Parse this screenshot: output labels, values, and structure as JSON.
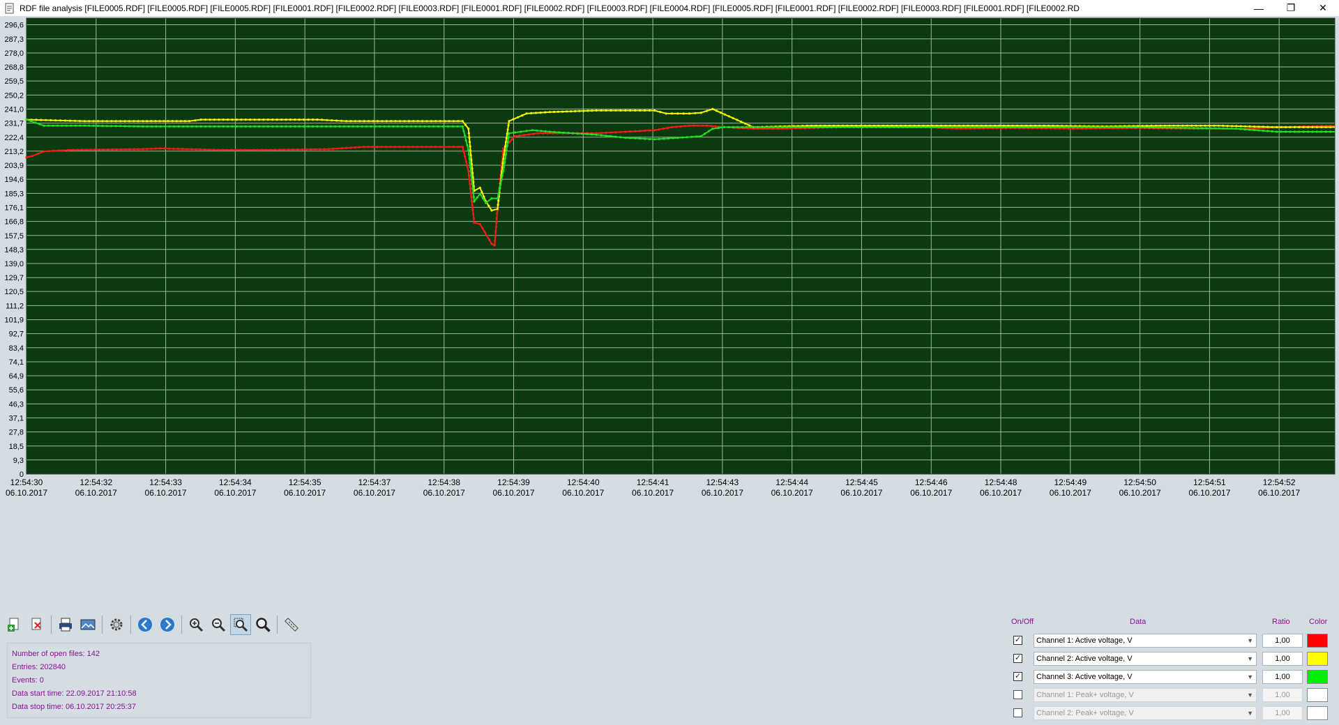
{
  "window": {
    "title": "RDF file analysis [FILE0005.RDF] [FILE0005.RDF] [FILE0005.RDF] [FILE0001.RDF] [FILE0002.RDF] [FILE0003.RDF] [FILE0001.RDF] [FILE0002.RDF] [FILE0003.RDF] [FILE0004.RDF] [FILE0005.RDF] [FILE0001.RDF] [FILE0002.RDF] [FILE0003.RDF] [FILE0001.RDF] [FILE0002.RD",
    "minimize": "—",
    "restore": "❐",
    "close": "✕"
  },
  "chart_data": {
    "type": "line",
    "title": "",
    "xlabel": "",
    "ylabel": "",
    "ylim": [
      0,
      301
    ],
    "grid": true,
    "legend": "none",
    "background_color": "#0c3a10",
    "grid_color": "#9fb79c",
    "y_ticks": [
      "0",
      "9,3",
      "18,5",
      "27,8",
      "37,1",
      "46,3",
      "55,6",
      "64,9",
      "74,1",
      "83,4",
      "92,7",
      "101,9",
      "111,2",
      "120,5",
      "129,7",
      "139,0",
      "148,3",
      "157,5",
      "166,8",
      "176,1",
      "185,3",
      "194,6",
      "203,9",
      "213,2",
      "222,4",
      "231,7",
      "241,0",
      "250,2",
      "259,5",
      "268,8",
      "278,0",
      "287,3",
      "296,6"
    ],
    "x_ticks": [
      {
        "time": "12:54:30",
        "date": "06.10.2017"
      },
      {
        "time": "12:54:32",
        "date": "06.10.2017"
      },
      {
        "time": "12:54:33",
        "date": "06.10.2017"
      },
      {
        "time": "12:54:34",
        "date": "06.10.2017"
      },
      {
        "time": "12:54:35",
        "date": "06.10.2017"
      },
      {
        "time": "12:54:37",
        "date": "06.10.2017"
      },
      {
        "time": "12:54:38",
        "date": "06.10.2017"
      },
      {
        "time": "12:54:39",
        "date": "06.10.2017"
      },
      {
        "time": "12:54:40",
        "date": "06.10.2017"
      },
      {
        "time": "12:54:41",
        "date": "06.10.2017"
      },
      {
        "time": "12:54:43",
        "date": "06.10.2017"
      },
      {
        "time": "12:54:44",
        "date": "06.10.2017"
      },
      {
        "time": "12:54:45",
        "date": "06.10.2017"
      },
      {
        "time": "12:54:46",
        "date": "06.10.2017"
      },
      {
        "time": "12:54:48",
        "date": "06.10.2017"
      },
      {
        "time": "12:54:49",
        "date": "06.10.2017"
      },
      {
        "time": "12:54:50",
        "date": "06.10.2017"
      },
      {
        "time": "12:54:51",
        "date": "06.10.2017"
      },
      {
        "time": "12:54:52",
        "date": "06.10.2017"
      }
    ],
    "x_domain": [
      0,
      22.5
    ],
    "series": [
      {
        "color": "#ff1a1a",
        "x": [
          0,
          0.1,
          0.3,
          0.8,
          2.0,
          2.3,
          3.3,
          4.2,
          5.2,
          5.8,
          6.8,
          7.5,
          7.6,
          7.7,
          7.8,
          8.0,
          8.05,
          8.1,
          8.2,
          8.4,
          8.8,
          9.3,
          9.8,
          10.3,
          10.8,
          11.1,
          11.4,
          11.7,
          12.0,
          12.5,
          13.0,
          14.0,
          15.5,
          16.0,
          17.0,
          18.0,
          19.0,
          20.0,
          21.0,
          21.6,
          22.5
        ],
        "y": [
          209,
          210,
          213,
          214,
          214.5,
          215,
          214,
          214,
          214.5,
          216,
          216,
          216,
          200,
          166,
          165,
          152,
          151,
          175,
          215,
          223,
          225,
          225,
          225,
          226,
          227,
          229,
          230,
          230,
          229,
          228,
          228,
          229,
          229,
          228,
          228.5,
          228,
          228.5,
          228,
          228,
          229,
          230
        ]
      },
      {
        "color": "#f5f500",
        "x": [
          0,
          0.5,
          1.0,
          2.0,
          2.8,
          3.0,
          4.0,
          5.0,
          5.5,
          6.5,
          7.5,
          7.6,
          7.7,
          7.8,
          7.9,
          8.0,
          8.1,
          8.2,
          8.3,
          8.6,
          9.0,
          9.8,
          10.3,
          10.8,
          11.0,
          11.2,
          11.4,
          11.6,
          11.8,
          12.5,
          13.5,
          14.5,
          15.5,
          16.5,
          17.5,
          18.5,
          19.5,
          20.5,
          21.5,
          22.5
        ],
        "y": [
          234,
          233.5,
          233,
          233,
          233,
          234,
          234,
          234,
          233,
          233,
          233,
          228,
          187,
          189,
          180,
          174,
          175,
          208,
          233,
          238,
          239,
          240,
          240,
          240,
          238,
          238,
          238,
          238.5,
          241,
          229,
          230,
          230,
          230,
          230,
          230,
          229.5,
          230,
          230,
          229,
          229
        ]
      },
      {
        "color": "#22dd22",
        "x": [
          0,
          0.15,
          0.3,
          1.0,
          2.0,
          3.0,
          4.0,
          5.0,
          6.0,
          7.0,
          7.5,
          7.6,
          7.7,
          7.8,
          7.9,
          8.0,
          8.1,
          8.2,
          8.3,
          8.5,
          8.7,
          9.0,
          9.4,
          9.8,
          10.3,
          10.8,
          11.2,
          11.6,
          11.8,
          12.0,
          13.0,
          14.0,
          15.0,
          16.0,
          17.0,
          18.0,
          19.0,
          20.0,
          20.8,
          21.5,
          22.5
        ],
        "y": [
          234,
          232,
          230,
          230,
          229.5,
          229.5,
          229.5,
          229.5,
          229.5,
          229.5,
          229.5,
          214,
          180,
          185,
          179,
          182,
          182,
          200,
          225,
          226,
          227,
          226,
          225,
          224,
          222,
          221,
          222,
          223,
          228,
          229,
          229,
          229,
          229,
          229,
          229,
          229,
          229,
          228.5,
          228,
          226,
          226
        ]
      }
    ]
  },
  "toolbar": {
    "items": [
      {
        "name": "add-file-button",
        "icon": "add-file-icon"
      },
      {
        "name": "remove-file-button",
        "icon": "remove-file-icon"
      },
      {
        "name": "print-button",
        "icon": "printer-icon"
      },
      {
        "name": "export-image-button",
        "icon": "image-export-icon"
      },
      {
        "name": "settings-button",
        "icon": "gear-icon"
      },
      {
        "name": "back-button",
        "icon": "arrow-left-icon"
      },
      {
        "name": "forward-button",
        "icon": "arrow-right-icon"
      },
      {
        "name": "zoom-in-button",
        "icon": "zoom-in-icon"
      },
      {
        "name": "zoom-out-button",
        "icon": "zoom-out-icon"
      },
      {
        "name": "zoom-area-button",
        "icon": "zoom-area-icon",
        "active": true
      },
      {
        "name": "zoom-fit-button",
        "icon": "zoom-fit-icon"
      },
      {
        "name": "measure-button",
        "icon": "ruler-icon"
      }
    ]
  },
  "info": {
    "open_files": "Number of open files: 142",
    "entries": "Entries: 202840",
    "events": "Events: 0",
    "start_time": "Data start time: 22.09.2017 21:10:58",
    "stop_time": "Data stop time: 06.10.2017 20:25:37"
  },
  "channels_panel": {
    "headers": {
      "onoff": "On/Off",
      "data": "Data",
      "ratio": "Ratio",
      "color": "Color"
    },
    "rows": [
      {
        "checked": true,
        "checkmark": "✓",
        "label": "Channel 1: Active voltage, V",
        "ratio": "1,00",
        "color": "#ff0000",
        "enabled": true
      },
      {
        "checked": true,
        "checkmark": "✓",
        "label": "Channel 2: Active voltage, V",
        "ratio": "1,00",
        "color": "#ffff00",
        "enabled": true
      },
      {
        "checked": true,
        "checkmark": "✓",
        "label": "Channel 3: Active voltage, V",
        "ratio": "1,00",
        "color": "#00ee00",
        "enabled": true
      },
      {
        "checked": false,
        "checkmark": "",
        "label": "Channel 1: Peak+ voltage, V",
        "ratio": "1,00",
        "color": "#ffffff",
        "enabled": false
      },
      {
        "checked": false,
        "checkmark": "",
        "label": "Channel 2: Peak+ voltage, V",
        "ratio": "1,00",
        "color": "#ffffff",
        "enabled": false
      }
    ],
    "dropdown_arrow": "▼"
  }
}
